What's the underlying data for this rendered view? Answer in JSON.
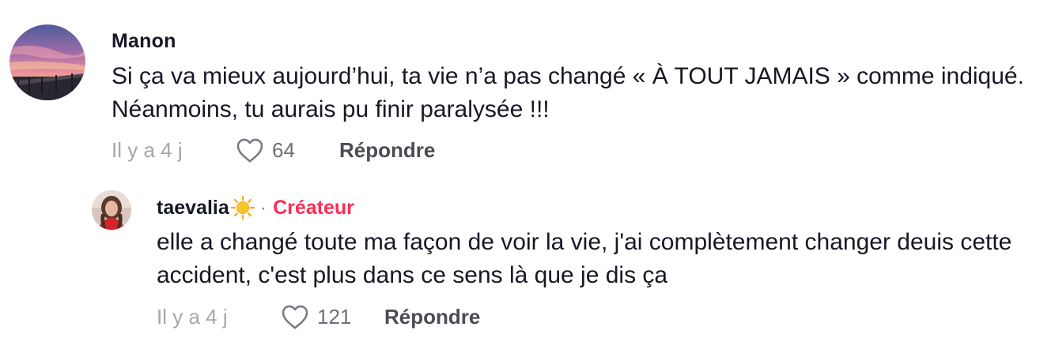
{
  "comments": {
    "main": {
      "username": "Manon",
      "text": "Si ça va mieux aujourd’hui, ta vie n’a pas changé « À TOUT JAMAIS » comme indiqué. Néanmoins, tu aurais pu finir paralysée !!!",
      "time": "Il y a 4 j",
      "likes": "64",
      "reply_label": "Répondre",
      "avatar_icon": "sunset-pier-avatar"
    },
    "reply": {
      "username": "taevalia",
      "username_emoji": "sun-icon",
      "separator": "·",
      "badge": "Créateur",
      "text": "elle a changé toute ma façon de voir la vie, j'ai complètement changer deuis cette accident, c'est plus dans ce sens là que je dis ça",
      "time": "Il y a 4 j",
      "likes": "121",
      "reply_label": "Répondre",
      "avatar_icon": "user-photo-avatar"
    }
  },
  "colors": {
    "text": "#161823",
    "muted": "#a5a6ab",
    "creator_badge": "#fe2c55",
    "reply_button": "#4b4c53"
  },
  "icons": {
    "like": "heart-outline-icon"
  }
}
